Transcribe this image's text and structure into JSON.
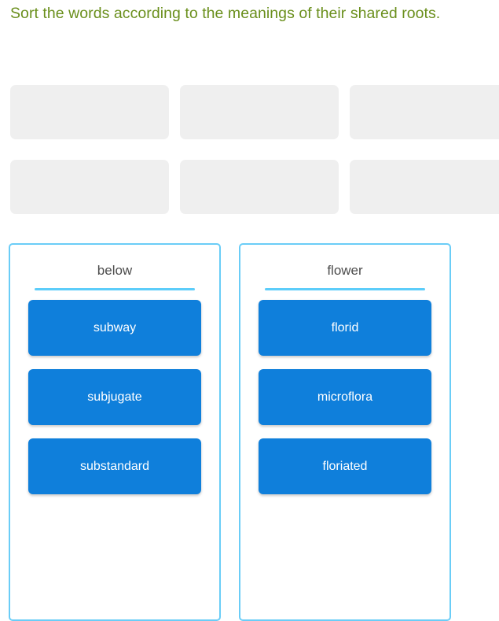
{
  "prompt": {
    "text": "Sort the words according to the meanings of their shared roots."
  },
  "colors": {
    "prompt_text": "#6a8f1c",
    "slot_fill": "#efefef",
    "column_border": "#6acdf7",
    "column_divider": "#5ccdfa",
    "chip_fill": "#0f7fdb",
    "chip_text": "#ffffff",
    "column_title_text": "#4c4c4c",
    "page_background": "#ffffff"
  },
  "slots": {
    "count": 6,
    "items": [
      {
        "label": ""
      },
      {
        "label": ""
      },
      {
        "label": ""
      },
      {
        "label": ""
      },
      {
        "label": ""
      },
      {
        "label": ""
      }
    ]
  },
  "columns": [
    {
      "title": "below",
      "chips": [
        {
          "label": "subway"
        },
        {
          "label": "subjugate"
        },
        {
          "label": "substandard"
        }
      ]
    },
    {
      "title": "flower",
      "chips": [
        {
          "label": "florid"
        },
        {
          "label": "microflora"
        },
        {
          "label": "floriated"
        }
      ]
    }
  ]
}
